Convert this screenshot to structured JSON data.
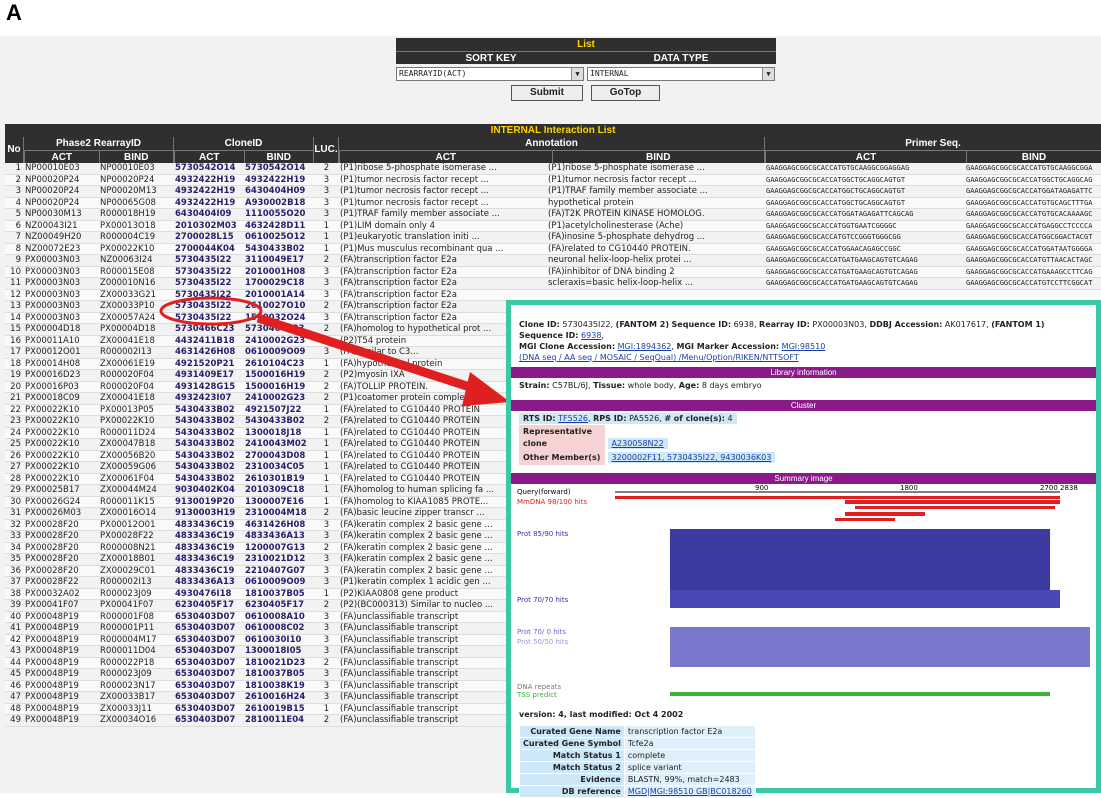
{
  "panel": "A",
  "list": {
    "title": "List",
    "sort_key_label": "SORT KEY",
    "data_type_label": "DATA TYPE",
    "sort_value": "REARRAYID(ACT)",
    "type_value": "INTERNAL",
    "submit": "Submit",
    "gotop": "GoTop"
  },
  "table": {
    "title": "INTERNAL Interaction List",
    "headers": {
      "no": "No",
      "phase2": "Phase2 RearrayID",
      "clone": "CloneID",
      "luc": "LUC.",
      "annotation": "Annotation",
      "primer": "Primer Seq.",
      "act": "ACT",
      "bind": "BIND"
    },
    "rows": [
      [
        "1",
        "NP00010E03",
        "NP00010E03",
        "5730542O14",
        "5730542O14",
        "2",
        "(P1)ribose 5-phosphate isomerase ...",
        "(P1)ribose 5-phosphate isomerase ...",
        "GAAGGAGCGGCGCACCATGTGCAAGGCGGAGGAG",
        "GAAGGAGCGGCGCACCATGTGCAAGGCGGA"
      ],
      [
        "2",
        "NP00020P24",
        "NP00020P24",
        "4932422H19",
        "4932422H19",
        "3",
        "(P1)tumor necrosis factor recept ...",
        "(P1)tumor necrosis factor recept ...",
        "GAAGGAGCGGCGCACCATGGCTGCAGGCAGTGT",
        "GAAGGAGCGGCGCACCATGGCTGCAGGCAG"
      ],
      [
        "3",
        "NP00020P24",
        "NP00020M13",
        "4932422H19",
        "6430404H09",
        "3",
        "(P1)tumor necrosis factor recept ...",
        "(P1)TRAF family member associate ...",
        "GAAGGAGCGGCGCACCATGGCTGCAGGCAGTGT",
        "GAAGGAGCGGCGCACCATGGATAGAGATTC"
      ],
      [
        "4",
        "NP00020P24",
        "NP00065G08",
        "4932422H19",
        "A930002B18",
        "3",
        "(P1)tumor necrosis factor recept ...",
        "hypothetical protein",
        "GAAGGAGCGGCGCACCATGGCTGCAGGCAGTGT",
        "GAAGGAGCGGCGCACCATGTGCAGCTTTGA"
      ],
      [
        "5",
        "NP00030M13",
        "R000018H19",
        "6430404I09",
        "1110055O20",
        "3",
        "(P1)TRAF family member associate ...",
        "(FA)T2K PROTEIN KINASE HOMOLOG.",
        "GAAGGAGCGGCGCACCATGGATAGAGATTCAGCAG",
        "GAAGGAGCGGCGCACCATGTGCACAAAAGC"
      ],
      [
        "6",
        "NZ00043I21",
        "PX00013O18",
        "2010302M03",
        "4632428D11",
        "1",
        "(P1)LIM domain only 4",
        "(P1)acetylcholinesterase (Ache)",
        "GAAGGAGCGGCGCACCATGGTGAATCGGGGC",
        "GAAGGAGCGGCGCACCATGAGGCCTCCCCA"
      ],
      [
        "7",
        "NZ00049H20",
        "R000004C19",
        "2700028L15",
        "0610025O12",
        "1",
        "(P1)eukaryotic translation initi ...",
        "(FA)inosine 5-phosphate dehydrog ...",
        "GAAGGAGCGGCGCACCATGTCCGGGTGGGCGG",
        "GAAGGAGCGGCGCACCATGGCGGACTACGT"
      ],
      [
        "8",
        "NZ00072E23",
        "PX00022K10",
        "2700044K04",
        "5430433B02",
        "1",
        "(P1)Mus musculus recombinant qua ...",
        "(FA)related to CG10440 PROTEIN.",
        "GAAGGAGCGGCGCACCATGGAACAGAGCCGGC",
        "GAAGGAGCGGCGCACCATGGATAATGGGGA"
      ],
      [
        "9",
        "PX00003N03",
        "NZ00063I24",
        "5730435I22",
        "3110049E17",
        "2",
        "(FA)transcription factor E2a",
        "neuronal helix-loop-helix protei ...",
        "GAAGGAGCGGCGCACCATGATGAAGCAGTGTCAGAG",
        "GAAGGAGCGGCGCACCATGTTAACACTAGC"
      ],
      [
        "10",
        "PX00003N03",
        "R000015E08",
        "5730435I22",
        "2010001H08",
        "3",
        "(FA)transcription factor E2a",
        "(FA)inhibitor of DNA binding 2",
        "GAAGGAGCGGCGCACCATGATGAAGCAGTGTCAGAG",
        "GAAGGAGCGGCGCACCATGAAAGCCTTCAG"
      ],
      [
        "11",
        "PX00003N03",
        "Z000010N16",
        "5730435I22",
        "1700029C18",
        "3",
        "(FA)transcription factor E2a",
        "scleraxis=basic helix-loop-helix ...",
        "GAAGGAGCGGCGCACCATGATGAAGCAGTGTCAGAG",
        "GAAGGAGCGGCGCACCATGTCCTTCGGCAT"
      ],
      [
        "12",
        "PX00003N03",
        "ZX00033G21",
        "5730435I22",
        "2010001A14",
        "3",
        "(FA)transcription factor E2a",
        "",
        "",
        " "
      ],
      [
        "13",
        "PX00003N03",
        "ZX00033P10",
        "5730435I22",
        "2610027O10",
        "2",
        "(FA)transcription factor E2a",
        "",
        "",
        ""
      ],
      [
        "14",
        "PX00003N03",
        "ZX00057A24",
        "5730435I22",
        "1500032O24",
        "3",
        "(FA)transcription factor E2a",
        "",
        "",
        ""
      ],
      [
        "15",
        "PX00004D18",
        "PX00004D18",
        "5730466C23",
        "5730466C23",
        "2",
        "(FA)homolog to hypothetical prot ...",
        "",
        "",
        ""
      ],
      [
        "16",
        "PX00011A10",
        "ZX00041E18",
        "4432411B18",
        "2410002G23",
        "2",
        "(P2)T54 protein",
        "",
        "",
        ""
      ],
      [
        "17",
        "PX00012O01",
        "R000002I13",
        "4631426H08",
        "0610009O09",
        "3",
        "(FA)similar to C3...",
        "",
        "",
        ""
      ],
      [
        "18",
        "PX00014H08",
        "ZX00061E19",
        "4921520P21",
        "2610104C23",
        "1",
        "(FA)hypothetical protein",
        "",
        "",
        ""
      ],
      [
        "19",
        "PX00016D23",
        "R000020F04",
        "4931409E17",
        "1500016H19",
        "2",
        "(P2)myosin IXA",
        "",
        "",
        ""
      ],
      [
        "20",
        "PX00016P03",
        "R000020F04",
        "4931428G15",
        "1500016H19",
        "2",
        "(FA)TOLLIP PROTEIN.",
        "",
        "",
        ""
      ],
      [
        "21",
        "PX00018C09",
        "ZX00041E18",
        "4932423I07",
        "2410002G23",
        "2",
        "(P1)coatomer protein complex, su ...",
        "",
        "",
        ""
      ],
      [
        "22",
        "PX00022K10",
        "PX00013P05",
        "5430433B02",
        "4921507J22",
        "1",
        "(FA)related to CG10440 PROTEIN",
        "",
        "",
        ""
      ],
      [
        "23",
        "PX00022K10",
        "PX00022K10",
        "5430433B02",
        "5430433B02",
        "2",
        "(FA)related to CG10440 PROTEIN",
        "",
        "",
        ""
      ],
      [
        "24",
        "PX00022K10",
        "R000011D24",
        "5430433B02",
        "1300018J18",
        "1",
        "(FA)related to CG10440 PROTEIN",
        "",
        "",
        ""
      ],
      [
        "25",
        "PX00022K10",
        "ZX00047B18",
        "5430433B02",
        "2410043M02",
        "1",
        "(FA)related to CG10440 PROTEIN",
        "",
        "",
        ""
      ],
      [
        "26",
        "PX00022K10",
        "ZX00056B20",
        "5430433B02",
        "2700043D08",
        "1",
        "(FA)related to CG10440 PROTEIN",
        "",
        "",
        ""
      ],
      [
        "27",
        "PX00022K10",
        "ZX00059G06",
        "5430433B02",
        "2310034C05",
        "1",
        "(FA)related to CG10440 PROTEIN",
        "",
        "",
        ""
      ],
      [
        "28",
        "PX00022K10",
        "ZX00061F04",
        "5430433B02",
        "2610301B19",
        "1",
        "(FA)related to CG10440 PROTEIN",
        "",
        "",
        ""
      ],
      [
        "29",
        "PX00025B17",
        "ZX00044M24",
        "9030402K04",
        "2010309C18",
        "1",
        "(FA)homolog to human splicing fa ...",
        "",
        "",
        ""
      ],
      [
        "30",
        "PX00026G24",
        "R000011K15",
        "9130019P20",
        "1300007E16",
        "1",
        "(FA)homolog to KIAA1085 PROTE...",
        "",
        "",
        ""
      ],
      [
        "31",
        "PX00026M03",
        "ZX00016O14",
        "9130003H19",
        "2310004M18",
        "2",
        "(FA)basic leucine zipper transcr ...",
        "",
        "",
        ""
      ],
      [
        "32",
        "PX00028F20",
        "PX00012O01",
        "4833436C19",
        "4631426H08",
        "3",
        "(FA)keratin complex 2 basic gene ...",
        "",
        "",
        ""
      ],
      [
        "33",
        "PX00028F20",
        "PX00028F22",
        "4833436C19",
        "4833436A13",
        "3",
        "(FA)keratin complex 2 basic gene ...",
        "",
        "",
        ""
      ],
      [
        "34",
        "PX00028F20",
        "R000008N21",
        "4833436C19",
        "1200007G13",
        "2",
        "(FA)keratin complex 2 basic gene ...",
        "",
        "",
        ""
      ],
      [
        "35",
        "PX00028F20",
        "ZX00018B01",
        "4833436C19",
        "2310021D12",
        "3",
        "(FA)keratin complex 2 basic gene ...",
        "",
        "",
        ""
      ],
      [
        "36",
        "PX00028F20",
        "ZX00029C01",
        "4833436C19",
        "2210407G07",
        "3",
        "(FA)keratin complex 2 basic gene ...",
        "",
        "",
        ""
      ],
      [
        "37",
        "PX00028F22",
        "R000002I13",
        "4833436A13",
        "0610009O09",
        "3",
        "(P1)keratin complex 1 acidic gen ...",
        "",
        "",
        ""
      ],
      [
        "38",
        "PX00032A02",
        "R000023J09",
        "4930476I18",
        "1810037B05",
        "1",
        "(P2)KIAA0808 gene product",
        "",
        "",
        ""
      ],
      [
        "39",
        "PX00041F07",
        "PX00041F07",
        "6230405F17",
        "6230405F17",
        "2",
        "(P2)(BC000313) Similar to nucleo ...",
        "",
        "",
        ""
      ],
      [
        "40",
        "PX00048P19",
        "R000001F08",
        "6530403D07",
        "0610008A10",
        "3",
        "(FA)unclassifiable transcript",
        "",
        "",
        ""
      ],
      [
        "41",
        "PX00048P19",
        "R000001P11",
        "6530403D07",
        "0610008C02",
        "3",
        "(FA)unclassifiable transcript",
        "",
        "",
        ""
      ],
      [
        "42",
        "PX00048P19",
        "R000004M17",
        "6530403D07",
        "0610030I10",
        "3",
        "(FA)unclassifiable transcript",
        "",
        "",
        ""
      ],
      [
        "43",
        "PX00048P19",
        "R000011D04",
        "6530403D07",
        "1300018I05",
        "3",
        "(FA)unclassifiable transcript",
        "",
        "",
        ""
      ],
      [
        "44",
        "PX00048P19",
        "R000022P18",
        "6530403D07",
        "1810021D23",
        "2",
        "(FA)unclassifiable transcript",
        "",
        "",
        ""
      ],
      [
        "45",
        "PX00048P19",
        "R000023J09",
        "6530403D07",
        "1810037B05",
        "3",
        "(FA)unclassifiable transcript",
        "",
        "",
        ""
      ],
      [
        "46",
        "PX00048P19",
        "R000023N17",
        "6530403D07",
        "1810038K19",
        "3",
        "(FA)unclassifiable transcript",
        "",
        "",
        ""
      ],
      [
        "47",
        "PX00048P19",
        "ZX00033B17",
        "6530403D07",
        "2610016H24",
        "3",
        "(FA)unclassifiable transcript",
        "",
        "",
        ""
      ],
      [
        "48",
        "PX00048P19",
        "ZX00033J11",
        "6530403D07",
        "2610019B15",
        "1",
        "(FA)unclassifiable transcript",
        "",
        "",
        ""
      ],
      [
        "49",
        "PX00048P19",
        "ZX00034O16",
        "6530403D07",
        "2810011E04",
        "2",
        "(FA)unclassifiable transcript",
        "",
        "",
        ""
      ]
    ]
  },
  "detail": {
    "line1_a": "Clone ID:",
    "clone_id": "5730435I22",
    "fantom2": "(FANTOM 2)",
    "seq_label": "Sequence ID:",
    "seq_id": "6938",
    "rearray_label": "Rearray ID:",
    "rearray_id": "PX00003N03",
    "ddbj_label": "DDBJ Accession:",
    "ddbj_id": "AK017617",
    "fantom1": "(FANTOM 1)",
    "seq_label2": "Sequence ID:",
    "seq_id2": "6938",
    "mgi_label": "MGI Clone Accession:",
    "mgi_id": "MGI:1894362",
    "mgi_marker_label": "MGI Marker Accession:",
    "mgi_marker": "MGI:98510",
    "links": "(DNA seq / AA seq / MOSAIC / SeqQual) /Menu/Option/RIKEN/NTTSOFT",
    "libinfo_bar": "Library information",
    "strain_label": "Strain:",
    "strain": "C57BL/6J",
    "tissue_label": "Tissue:",
    "tissue": "whole body",
    "age_label": "Age:",
    "age": "8 days embryo",
    "cluster_bar": "Cluster",
    "rts_label": "RTS ID:",
    "rts": "TF5526",
    "rps_label": "RPS ID:",
    "rps": "PA5526",
    "nclones_label": "# of clone(s):",
    "nclones": "4",
    "rep_label": "Representative clone",
    "rep": "A230058N22",
    "other_label": "Other Member(s)",
    "other": "3200002F11, 5730435I22, 9430036K03",
    "summary_bar": "Summary image",
    "q_label": "Query(forward)",
    "ticks": [
      "900",
      "1800",
      "2700"
    ],
    "qlen": "2838",
    "mdna": "MmDNA 98/100 hits",
    "prot1": "Prot 85/90 hits",
    "prot2": "Prot 70/70 hits",
    "prot3": "Prot 70/ 0 hits",
    "prot4": "Prot 50/50 hits",
    "dna_repeats": "DNA repeats",
    "tss": "TSS predict",
    "version": "version: 4, last modified: Oct 4 2002",
    "gene": [
      [
        "Curated Gene Name",
        "transcription factor E2a"
      ],
      [
        "Curated Gene Symbol",
        "Tcfe2a"
      ],
      [
        "Match Status 1",
        "complete"
      ],
      [
        "Match Status 2",
        "splice variant"
      ],
      [
        "Evidence",
        "BLASTN, 99%, match=2483"
      ],
      [
        "DB reference",
        "MGD|MGI:98510 GB|BC018260"
      ]
    ]
  },
  "colors": {
    "overlay_border": "#3cc7a6",
    "arrow": "#e02020",
    "section_bar": "#8a1a8a",
    "header_bg": "#2f2f2f",
    "title_text": "#ffd200"
  }
}
